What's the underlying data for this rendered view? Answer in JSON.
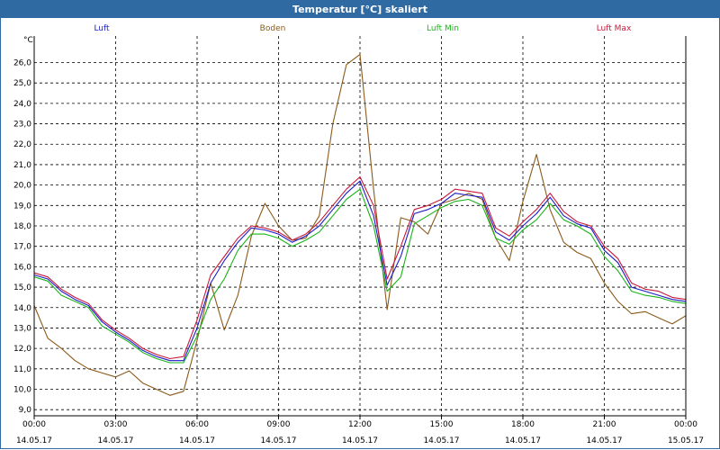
{
  "window": {
    "title": "Temperatur [°C] skaliert"
  },
  "colors": {
    "title_bar": "#2f6aa3",
    "luft": "#1b1bc8",
    "boden": "#8b5a1a",
    "luft_min": "#18b418",
    "luft_max": "#c8183c",
    "grid": "#000000"
  },
  "chart_data": {
    "type": "line",
    "title": "Temperatur [°C] skaliert",
    "ylabel": "°C",
    "xlabel": "",
    "ylim": [
      8.7,
      27.3
    ],
    "yticks": [
      "9,0",
      "10,0",
      "11,0",
      "12,0",
      "13,0",
      "14,0",
      "15,0",
      "16,0",
      "17,0",
      "18,0",
      "19,0",
      "20,0",
      "21,0",
      "22,0",
      "23,0",
      "24,0",
      "25,0",
      "26,0"
    ],
    "x_ticks": [
      {
        "time": "00:00",
        "date": "14.05.17",
        "hour": 0
      },
      {
        "time": "03:00",
        "date": "14.05.17",
        "hour": 3
      },
      {
        "time": "06:00",
        "date": "14.05.17",
        "hour": 6
      },
      {
        "time": "09:00",
        "date": "14.05.17",
        "hour": 9
      },
      {
        "time": "12:00",
        "date": "14.05.17",
        "hour": 12
      },
      {
        "time": "15:00",
        "date": "14.05.17",
        "hour": 15
      },
      {
        "time": "18:00",
        "date": "14.05.17",
        "hour": 18
      },
      {
        "time": "21:00",
        "date": "14.05.17",
        "hour": 21
      },
      {
        "time": "00:00",
        "date": "15.05.17",
        "hour": 24
      }
    ],
    "legend_placement": "top",
    "grid": true,
    "x_hours": [
      0,
      0.5,
      1,
      1.5,
      2,
      2.5,
      3,
      3.5,
      4,
      4.5,
      5,
      5.5,
      6,
      6.5,
      7,
      7.5,
      8,
      8.5,
      9,
      9.5,
      10,
      10.5,
      11,
      11.5,
      12,
      12.5,
      13,
      13.5,
      14,
      14.5,
      15,
      15.5,
      16,
      16.5,
      17,
      17.5,
      18,
      18.5,
      19,
      19.5,
      20,
      20.5,
      21,
      21.5,
      22,
      22.5,
      23,
      23.5,
      24
    ],
    "series": [
      {
        "name": "Luft",
        "color": "#1b1bc8",
        "values": [
          15.6,
          15.4,
          14.8,
          14.4,
          14.1,
          13.3,
          12.8,
          12.4,
          11.9,
          11.6,
          11.4,
          11.4,
          13.0,
          15.2,
          16.3,
          17.2,
          17.9,
          17.8,
          17.6,
          17.2,
          17.5,
          18.0,
          18.8,
          19.6,
          20.2,
          18.5,
          15.1,
          16.5,
          18.6,
          18.8,
          19.1,
          19.6,
          19.5,
          19.4,
          17.7,
          17.3,
          18.0,
          18.6,
          19.4,
          18.5,
          18.1,
          17.9,
          16.8,
          16.2,
          15.0,
          14.8,
          14.6,
          14.4,
          14.3
        ]
      },
      {
        "name": "Boden",
        "color": "#8b5a1a",
        "values": [
          14.1,
          12.5,
          12.0,
          11.4,
          11.0,
          10.8,
          10.6,
          10.9,
          10.3,
          10.0,
          9.7,
          9.9,
          12.4,
          15.2,
          12.9,
          14.6,
          17.5,
          19.1,
          18.0,
          17.3,
          17.4,
          18.5,
          23.0,
          25.9,
          26.4,
          19.8,
          13.9,
          18.4,
          18.2,
          17.6,
          19.1,
          19.3,
          19.6,
          19.3,
          17.4,
          16.3,
          19.2,
          21.5,
          18.8,
          17.2,
          16.7,
          16.4,
          15.2,
          14.3,
          13.7,
          13.8,
          13.5,
          13.2,
          13.6
        ]
      },
      {
        "name": "Luft Min",
        "color": "#18b418",
        "values": [
          15.5,
          15.3,
          14.6,
          14.3,
          14.0,
          13.1,
          12.7,
          12.3,
          11.8,
          11.5,
          11.3,
          11.3,
          12.6,
          14.4,
          15.4,
          16.8,
          17.6,
          17.6,
          17.4,
          17.0,
          17.3,
          17.7,
          18.5,
          19.3,
          19.8,
          18.0,
          14.8,
          15.5,
          18.1,
          18.5,
          18.9,
          19.2,
          19.3,
          19.0,
          17.4,
          17.1,
          17.8,
          18.3,
          19.1,
          18.3,
          18.0,
          17.6,
          16.5,
          15.8,
          14.8,
          14.6,
          14.5,
          14.3,
          14.2
        ]
      },
      {
        "name": "Luft Max",
        "color": "#c8183c",
        "values": [
          15.7,
          15.5,
          14.9,
          14.5,
          14.2,
          13.4,
          12.9,
          12.5,
          12.0,
          11.7,
          11.5,
          11.6,
          13.4,
          15.6,
          16.5,
          17.4,
          18.0,
          17.9,
          17.7,
          17.3,
          17.6,
          18.2,
          19.0,
          19.8,
          20.4,
          19.0,
          15.4,
          17.0,
          18.8,
          19.0,
          19.3,
          19.8,
          19.7,
          19.6,
          17.9,
          17.5,
          18.2,
          18.8,
          19.6,
          18.7,
          18.2,
          18.0,
          17.0,
          16.4,
          15.2,
          14.9,
          14.8,
          14.5,
          14.4
        ]
      }
    ]
  }
}
